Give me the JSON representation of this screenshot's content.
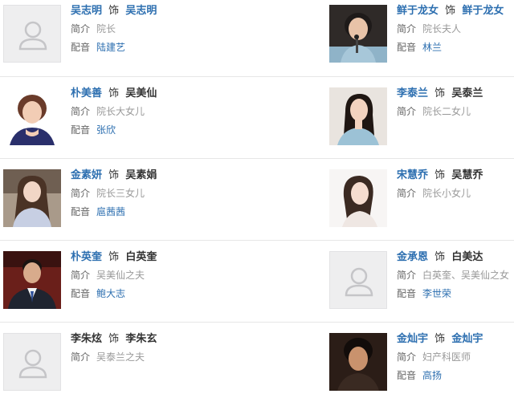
{
  "labels": {
    "shi": "饰",
    "intro": "简介",
    "dub": "配音"
  },
  "cast": [
    {
      "actor": "吴志明",
      "role": "吴志明",
      "role_color": "blue",
      "intro": "院长",
      "dubber": "陆建艺",
      "photo": "placeholder-avatar"
    },
    {
      "actor": "鲜于龙女",
      "role": "鲜于龙女",
      "role_color": "blue",
      "intro": "院长夫人",
      "dubber": "林兰",
      "photo": "woman-speaking-photo"
    },
    {
      "actor": "朴美善",
      "role": "吴美仙",
      "role_color": "black",
      "intro": "院长大女儿",
      "dubber": "张欣",
      "photo": "smiling-woman-photo"
    },
    {
      "actor": "李泰兰",
      "role": "吴泰兰",
      "role_color": "black",
      "intro": "院长二女儿",
      "dubber": "",
      "photo": "young-woman-photo"
    },
    {
      "actor": "金素妍",
      "role": "吴素娟",
      "role_color": "black",
      "intro": "院长三女儿",
      "dubber": "扈茜茜",
      "photo": "woman-longhair-photo"
    },
    {
      "actor": "宋慧乔",
      "role": "吴慧乔",
      "role_color": "black",
      "intro": "院长小女儿",
      "dubber": "",
      "photo": "woman-white-bg-photo"
    },
    {
      "actor": "朴英奎",
      "role": "白英奎",
      "role_color": "black",
      "intro": "吴美仙之夫",
      "dubber": "鲍大志",
      "photo": "man-suit-photo"
    },
    {
      "actor": "金承恩",
      "role": "白美达",
      "role_color": "black",
      "intro": "白英奎、吴美仙之女",
      "dubber": "李世荣",
      "photo": "placeholder-avatar"
    },
    {
      "actor": "李朱炫",
      "role": "李朱玄",
      "role_color": "black",
      "intro": "吴泰兰之夫",
      "dubber": "",
      "photo": "placeholder-avatar"
    },
    {
      "actor": "金灿宇",
      "role": "金灿宇",
      "role_color": "blue",
      "intro": "妇产科医师",
      "dubber": "高扬",
      "photo": "man-portrait-photo"
    }
  ]
}
